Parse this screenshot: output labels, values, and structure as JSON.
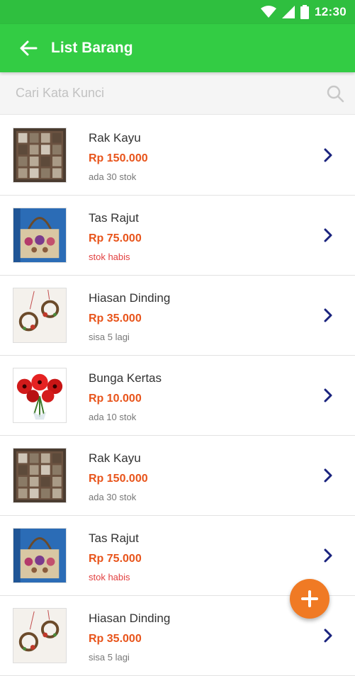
{
  "status_bar": {
    "time": "12:30",
    "icons": [
      "wifi-icon",
      "signal-icon",
      "battery-icon"
    ]
  },
  "app_bar": {
    "title": "List Barang",
    "back_icon": "arrow-left-icon"
  },
  "search": {
    "placeholder": "Cari Kata Kunci",
    "value": "",
    "icon": "search-icon"
  },
  "items": [
    {
      "name": "Rak Kayu",
      "price": "Rp 150.000",
      "stock": "ada 30 stok",
      "stock_status": "available",
      "image": "wooden-shelf"
    },
    {
      "name": "Tas Rajut",
      "price": "Rp 75.000",
      "stock": "stok habis",
      "stock_status": "out",
      "image": "knit-bag"
    },
    {
      "name": "Hiasan Dinding",
      "price": "Rp 35.000",
      "stock": "sisa 5 lagi",
      "stock_status": "low",
      "image": "wall-wreath"
    },
    {
      "name": "Bunga Kertas",
      "price": "Rp 10.000",
      "stock": "ada 10 stok",
      "stock_status": "available",
      "image": "paper-flower"
    },
    {
      "name": "Rak Kayu",
      "price": "Rp 150.000",
      "stock": "ada 30 stok",
      "stock_status": "available",
      "image": "wooden-shelf"
    },
    {
      "name": "Tas Rajut",
      "price": "Rp 75.000",
      "stock": "stok habis",
      "stock_status": "out",
      "image": "knit-bag"
    },
    {
      "name": "Hiasan Dinding",
      "price": "Rp 35.000",
      "stock": "sisa 5 lagi",
      "stock_status": "low",
      "image": "wall-wreath"
    }
  ],
  "fab": {
    "icon": "plus-icon"
  },
  "colors": {
    "app_bar": "#33cc44",
    "status_bar": "#2fbf3f",
    "price": "#e8541b",
    "stock_out": "#e24040",
    "chevron": "#1a237e",
    "fab": "#f07a24"
  }
}
